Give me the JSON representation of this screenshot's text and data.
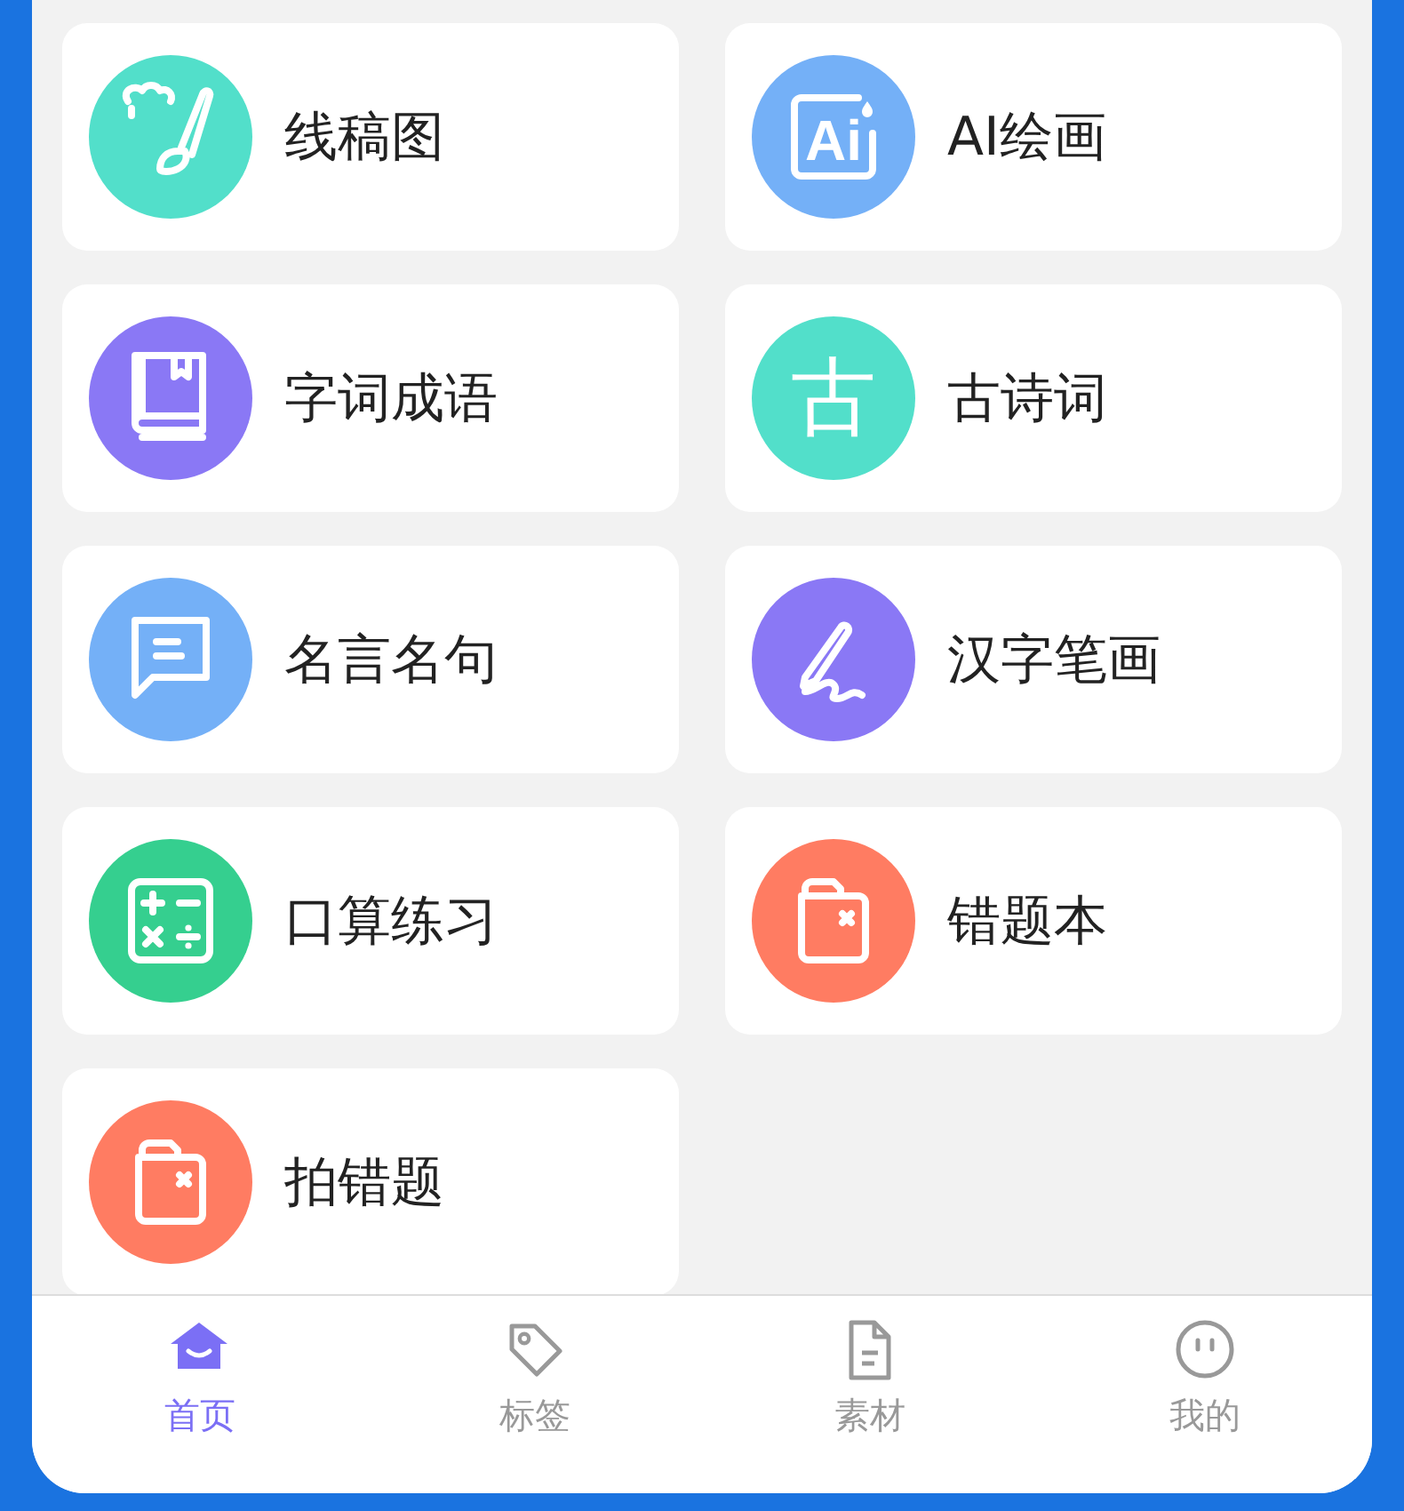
{
  "items": [
    {
      "label": "线稿图",
      "kind": "brush",
      "color": "#52dfca"
    },
    {
      "label": "AI绘画",
      "kind": "ai",
      "glyph": "Ai",
      "color": "#74b0f7"
    },
    {
      "label": "字词成语",
      "kind": "book",
      "color": "#8a78f5"
    },
    {
      "label": "古诗词",
      "kind": "glyph",
      "glyph": "古",
      "color": "#52dfca"
    },
    {
      "label": "名言名句",
      "kind": "chat",
      "color": "#74b0f7"
    },
    {
      "label": "汉字笔画",
      "kind": "pen",
      "color": "#8a78f5"
    },
    {
      "label": "口算练习",
      "kind": "calc",
      "color": "#35cf8f"
    },
    {
      "label": "错题本",
      "kind": "folder",
      "color": "#ff7c62"
    },
    {
      "label": "拍错题",
      "kind": "folder",
      "color": "#ff7c62"
    }
  ],
  "tab_bar": [
    {
      "label": "首页",
      "selected": true
    },
    {
      "label": "标签",
      "selected": false
    },
    {
      "label": "素材",
      "selected": false
    },
    {
      "label": "我的",
      "selected": false
    }
  ]
}
